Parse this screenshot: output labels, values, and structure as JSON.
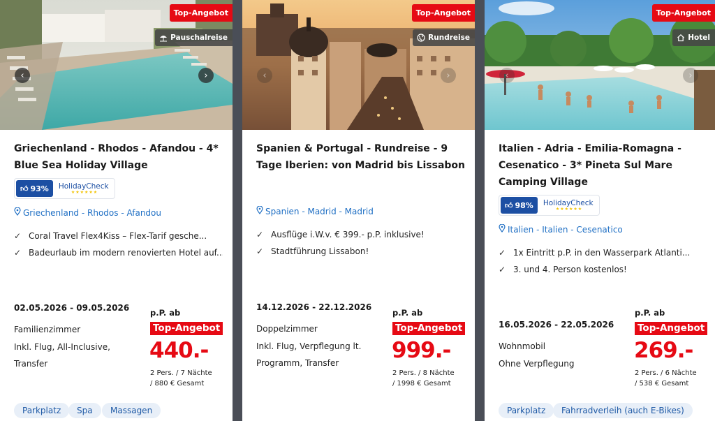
{
  "colors": {
    "accent_red": "#e60a14",
    "link_blue": "#1f6fc4",
    "holidaycheck_blue": "#1c4fa3",
    "tag_bg": "#e8eff8"
  },
  "cards": [
    {
      "badge_top": "Top-Angebot",
      "type": {
        "label": "Pauschalreise",
        "icon": "umbrella-icon"
      },
      "title": "Griechenland - Rhodos - Afandou - 4* Blue Sea Holiday Village",
      "rating": {
        "score": "93%",
        "provider": "HolidayCheck"
      },
      "location": "Griechenland - Rhodos - Afandou",
      "features": [
        "Coral Travel Flex4Kiss – Flex-Tarif gesche...",
        "Badeurlaub im modern renovierten Hotel auf..."
      ],
      "dates": "02.05.2026 - 09.05.2026",
      "details": [
        "Familienzimmer",
        "Inkl. Flug, All-Inclusive,",
        "Transfer"
      ],
      "pp_label": "p.P. ab",
      "offer_label": "Top-Angebot",
      "price": "440.-",
      "persons": "2 Pers. / 7 Nächte",
      "total": "/ 880 € Gesamt",
      "tags": [
        "Parkplatz",
        "Spa",
        "Massagen"
      ]
    },
    {
      "badge_top": "Top-Angebot",
      "type": {
        "label": "Rundreise",
        "icon": "globe-icon"
      },
      "title": "Spanien & Portugal - Rundreise - 9 Tage Iberien: von Madrid bis Lissabon",
      "location": "Spanien - Madrid - Madrid",
      "features": [
        "Ausflüge i.W.v. € 399.- p.P. inklusive!",
        "Stadtführung Lissabon!"
      ],
      "dates": "14.12.2026 - 22.12.2026",
      "details": [
        "Doppelzimmer",
        "Inkl. Flug, Verpflegung lt.",
        "Programm, Transfer"
      ],
      "pp_label": "p.P. ab",
      "offer_label": "Top-Angebot",
      "price": "999.-",
      "persons": "2 Pers. / 8 Nächte",
      "total": "/ 1998 € Gesamt",
      "tags": []
    },
    {
      "badge_top": "Top-Angebot",
      "type": {
        "label": "Hotel",
        "icon": "house-icon"
      },
      "title": "Italien - Adria - Emilia-Romagna - Cesenatico - 3* Pineta Sul Mare Camping Village",
      "rating": {
        "score": "98%",
        "provider": "HolidayCheck"
      },
      "location": "Italien - Italien - Cesenatico",
      "features": [
        "1x Eintritt p.P. in den Wasserpark Atlanti...",
        "3. und 4. Person kostenlos!"
      ],
      "dates": "16.05.2026 - 22.05.2026",
      "details": [
        "Wohnmobil",
        "Ohne Verpflegung"
      ],
      "pp_label": "p.P. ab",
      "offer_label": "Top-Angebot",
      "price": "269.-",
      "persons": "2 Pers. / 6 Nächte",
      "total": "/ 538 € Gesamt",
      "tags": [
        "Parkplatz",
        "Fahrradverleih (auch E-Bikes)"
      ]
    }
  ]
}
